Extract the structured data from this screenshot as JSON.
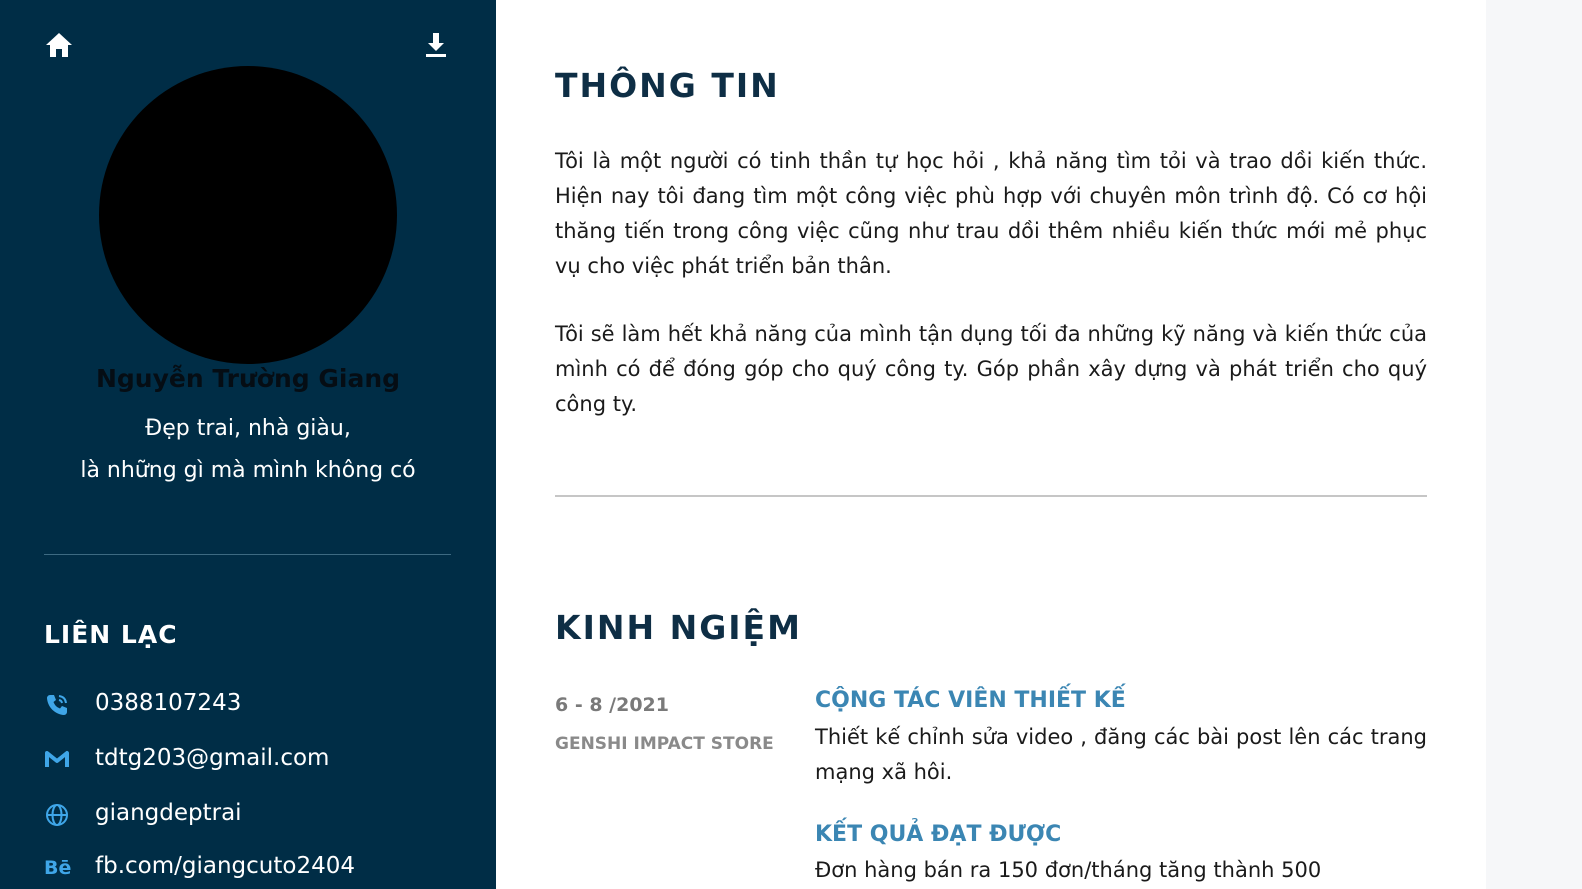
{
  "profile": {
    "name": "Nguyễn Trường Giang",
    "tagline_line1": "Đẹp trai, nhà giàu,",
    "tagline_line2": "là những gì mà mình không có"
  },
  "icons": {
    "home": "home-icon",
    "download": "download-icon",
    "phone": "phone-icon",
    "gmail": "gmail-icon",
    "globe": "globe-icon",
    "behance": "behance-icon"
  },
  "contact": {
    "title": "LIÊN LẠC",
    "behance_glyph": "Bē",
    "phone": "0388107243",
    "email": "tdtg203@gmail.com",
    "website": "giangdeptrai",
    "social": "fb.com/giangcuto2404"
  },
  "about": {
    "title": "THÔNG TIN",
    "paragraph1": "Tôi là một người có tinh thần tự học hỏi , khả năng tìm tỏi và trao dồi kiến thức. Hiện nay tôi đang tìm một công việc phù hợp với chuyên môn trình độ. Có cơ hội thăng tiến trong công việc cũng như trau dồi thêm nhiều kiến thức mới mẻ phục vụ cho việc phát triển bản thân.",
    "paragraph2": "Tôi sẽ làm hết khả năng của mình tận dụng tối đa những kỹ năng và kiến thức của mình có để đóng góp cho quý công ty. Góp phần xây dựng và phát triển cho quý công ty."
  },
  "experience": {
    "title": "KINH NGIỆM",
    "items": [
      {
        "date": "6 - 8 /2021",
        "company": "GENSHI IMPACT STORE",
        "role": "CỘNG TÁC VIÊN THIẾT KẾ",
        "description": "Thiết kế chỉnh sửa video , đăng các bài post lên các trang mạng xã hôi.",
        "result_title": "KẾT QUẢ ĐẠT ĐƯỢC",
        "result_description": "Đơn hàng bán ra 150 đơn/tháng tăng thành 500"
      }
    ]
  },
  "colors": {
    "sidebar_bg": "#002d46",
    "heading": "#0e2e45",
    "accent": "#3b86b3",
    "icon_blue": "#3fa6e8"
  }
}
